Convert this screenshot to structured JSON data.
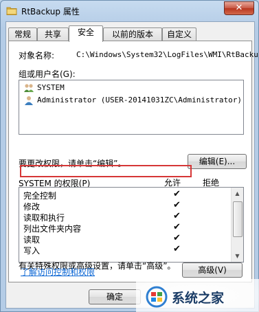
{
  "window": {
    "title": "RtBackup 属性",
    "close_label": "✕"
  },
  "tabs": [
    "常规",
    "共享",
    "安全",
    "以前的版本",
    "自定义"
  ],
  "active_tab": "安全",
  "object_name": {
    "label": "对象名称:",
    "value": "C:\\Windows\\System32\\LogFiles\\WMI\\RtBacku"
  },
  "groups": {
    "label": "组或用户名(G):",
    "items": [
      {
        "name": "SYSTEM",
        "icon": "users-group-icon"
      },
      {
        "name": "Administrator (USER-20141031ZC\\Administrator)",
        "icon": "user-icon"
      }
    ]
  },
  "change_perm": {
    "text": "要更改权限，请单击“编辑”。",
    "button": "编辑(E)..."
  },
  "permissions": {
    "header": "SYSTEM 的权限(P)",
    "allow": "允许",
    "deny": "拒绝",
    "rows": [
      {
        "name": "完全控制",
        "allow": true,
        "deny": false
      },
      {
        "name": "修改",
        "allow": true,
        "deny": false
      },
      {
        "name": "读取和执行",
        "allow": true,
        "deny": false
      },
      {
        "name": "列出文件夹内容",
        "allow": true,
        "deny": false
      },
      {
        "name": "读取",
        "allow": true,
        "deny": false
      },
      {
        "name": "写入",
        "allow": true,
        "deny": false
      }
    ],
    "check_glyph": "✔"
  },
  "advanced": {
    "text": "有关特殊权限或高级设置，请单击“高级”。",
    "button": "高级(V)"
  },
  "link": "了解访问控制和权限",
  "footer": {
    "ok": "确定"
  },
  "watermark": {
    "text": "系统之家"
  },
  "colors": {
    "highlight": "#d63636",
    "link": "#0b66d4"
  }
}
